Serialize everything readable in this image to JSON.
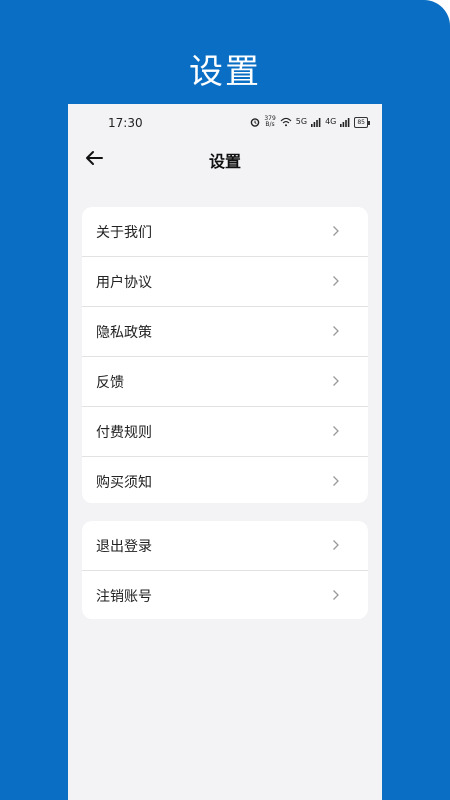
{
  "promo": {
    "title": "设置"
  },
  "status_bar": {
    "time": "17:30",
    "net_speed": "379",
    "net_unit": "B/s",
    "sig1": "5G",
    "sig2": "4G",
    "battery": "85"
  },
  "nav": {
    "title": "设置"
  },
  "menu_group_1": [
    {
      "label": "关于我们"
    },
    {
      "label": "用户协议"
    },
    {
      "label": "隐私政策"
    },
    {
      "label": "反馈"
    },
    {
      "label": "付费规则"
    },
    {
      "label": "购买须知"
    }
  ],
  "menu_group_2": [
    {
      "label": "退出登录"
    },
    {
      "label": "注销账号"
    }
  ],
  "colors": {
    "brand_blue": "#0a6fc4",
    "page_bg": "#f3f2f5",
    "card_bg": "#ffffff",
    "divider": "#e2e2e2",
    "chevron": "#9a9a9a"
  }
}
